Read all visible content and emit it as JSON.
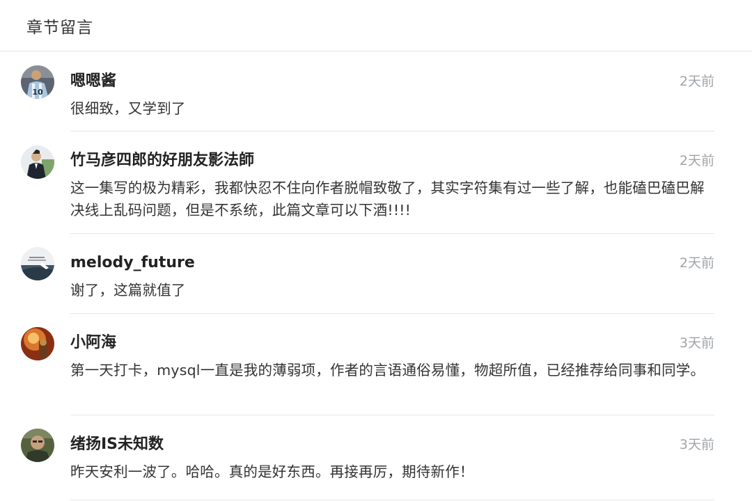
{
  "header": {
    "title": "章节留言"
  },
  "comments": [
    {
      "name": "嗯嗯酱",
      "time": "2天前",
      "text": "很细致，又学到了"
    },
    {
      "name": "竹马彦四郎的好朋友影法師",
      "time": "2天前",
      "text": "这一集写的极为精彩，我都快忍不住向作者脱帽致敬了，其实字符集有过一些了解，也能磕巴磕巴解决线上乱码问题，但是不系统，此篇文章可以下酒!!!!"
    },
    {
      "name": "melody_future",
      "time": "2天前",
      "text": "谢了，这篇就值了"
    },
    {
      "name": "小阿海",
      "time": "3天前",
      "text": "第一天打卡，mysql一直是我的薄弱项，作者的言语通俗易懂，物超所值，已经推荐给同事和同学。"
    },
    {
      "name": "绪扬IS未知数",
      "time": "3天前",
      "text": "昨天安利一波了。哈哈。真的是好东西。再接再厉，期待新作！"
    }
  ]
}
